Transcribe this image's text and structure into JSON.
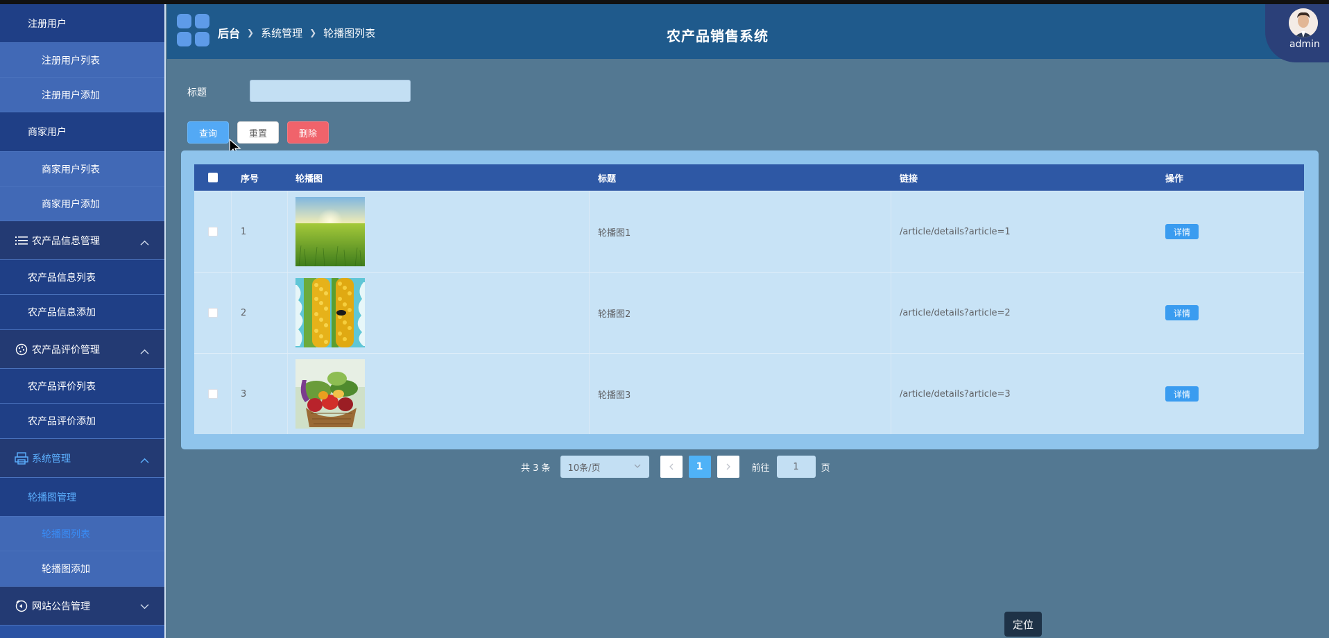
{
  "app": {
    "system_title": "农产品销售系统",
    "username": "admin"
  },
  "breadcrumb": [
    "后台",
    "系统管理",
    "轮播图列表"
  ],
  "sidebar": {
    "items": [
      {
        "label": "注册用户",
        "level": 1
      },
      {
        "label": "注册用户列表",
        "level": 2
      },
      {
        "label": "注册用户添加",
        "level": 2
      },
      {
        "label": "商家用户",
        "level": 1
      },
      {
        "label": "商家用户列表",
        "level": 2
      },
      {
        "label": "商家用户添加",
        "level": 2
      },
      {
        "label": "农产品信息管理",
        "level": 0,
        "icon": "list-icon"
      },
      {
        "label": "农产品信息列表",
        "level": 1
      },
      {
        "label": "农产品信息添加",
        "level": 1
      },
      {
        "label": "农产品评价管理",
        "level": 0,
        "icon": "palette-icon"
      },
      {
        "label": "农产品评价列表",
        "level": 1
      },
      {
        "label": "农产品评价添加",
        "level": 1
      },
      {
        "label": "系统管理",
        "level": 0,
        "icon": "printer-icon",
        "active": true
      },
      {
        "label": "轮播图管理",
        "level": 1,
        "active": true
      },
      {
        "label": "轮播图列表",
        "level": 2,
        "current": true
      },
      {
        "label": "轮播图添加",
        "level": 2
      },
      {
        "label": "网站公告管理",
        "level": 0,
        "icon": "announce-icon"
      }
    ]
  },
  "search": {
    "label": "标题",
    "value": "",
    "placeholder": ""
  },
  "buttons": {
    "query": "查询",
    "reset": "重置",
    "delete": "删除"
  },
  "table": {
    "headers": [
      "序号",
      "轮播图",
      "标题",
      "链接",
      "操作"
    ],
    "rows": [
      {
        "index": "1",
        "image": "grass-field-photo",
        "title": "轮播图1",
        "link": "/article/details?article=1",
        "action": "详情"
      },
      {
        "index": "2",
        "image": "corn-photo",
        "title": "轮播图2",
        "link": "/article/details?article=2",
        "action": "详情"
      },
      {
        "index": "3",
        "image": "vegetables-basket-photo",
        "title": "轮播图3",
        "link": "/article/details?article=3",
        "action": "详情"
      }
    ]
  },
  "pagination": {
    "total": "共 3 条",
    "page_size": "10条/页",
    "current_page": "1",
    "goto_label": "前往",
    "goto_value": "1",
    "page_suffix": "页"
  },
  "locate_button": "定位",
  "colors": {
    "sidebar_bg": "#2a52a3",
    "header_bg": "#1f5a8c",
    "content_bg": "#537892",
    "table_header_bg": "#2e58a5",
    "primary": "#53a9f5",
    "danger": "#f0636b"
  }
}
